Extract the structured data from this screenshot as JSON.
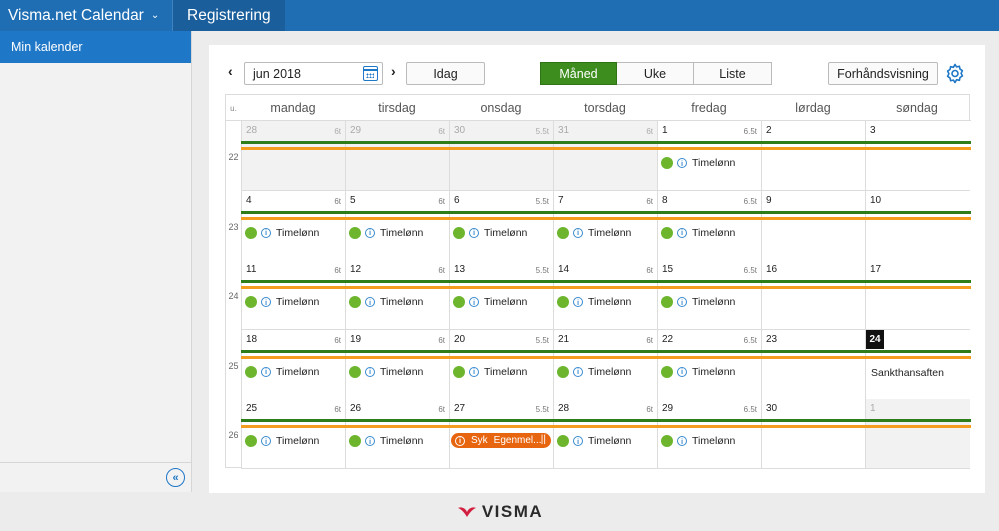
{
  "topbar": {
    "app_name": "Visma.net Calendar",
    "tab": "Registrering"
  },
  "sidebar": {
    "items": [
      {
        "label": "Min kalender"
      }
    ],
    "collapse_icon": "double-chevron-left-icon"
  },
  "toolbar": {
    "prev_icon": "chevron-left-icon",
    "next_icon": "chevron-right-icon",
    "date_value": "jun 2018",
    "today_label": "Idag",
    "views": [
      "Måned",
      "Uke",
      "Liste"
    ],
    "active_view": "Måned",
    "preview_label": "Forhåndsvisning",
    "settings_icon": "gear-icon"
  },
  "calendar": {
    "week_col_label": "u.",
    "day_headers": [
      "mandag",
      "tirsdag",
      "onsdag",
      "torsdag",
      "fredag",
      "lørdag",
      "søndag"
    ],
    "weeks": [
      {
        "num": "22",
        "days": [
          {
            "d": "28",
            "h": "6t",
            "other": true
          },
          {
            "d": "29",
            "h": "6t",
            "other": true
          },
          {
            "d": "30",
            "h": "5.5t",
            "other": true
          },
          {
            "d": "31",
            "h": "6t",
            "other": true
          },
          {
            "d": "1",
            "h": "6.5t",
            "event": "Timelønn"
          },
          {
            "d": "2"
          },
          {
            "d": "3"
          }
        ]
      },
      {
        "num": "23",
        "days": [
          {
            "d": "4",
            "h": "6t",
            "event": "Timelønn"
          },
          {
            "d": "5",
            "h": "6t",
            "event": "Timelønn"
          },
          {
            "d": "6",
            "h": "5.5t",
            "event": "Timelønn"
          },
          {
            "d": "7",
            "h": "6t",
            "event": "Timelønn"
          },
          {
            "d": "8",
            "h": "6.5t",
            "event": "Timelønn"
          },
          {
            "d": "9"
          },
          {
            "d": "10"
          }
        ]
      },
      {
        "num": "24",
        "days": [
          {
            "d": "11",
            "h": "6t",
            "event": "Timelønn"
          },
          {
            "d": "12",
            "h": "6t",
            "event": "Timelønn"
          },
          {
            "d": "13",
            "h": "5.5t",
            "event": "Timelønn"
          },
          {
            "d": "14",
            "h": "6t",
            "event": "Timelønn"
          },
          {
            "d": "15",
            "h": "6.5t",
            "event": "Timelønn"
          },
          {
            "d": "16"
          },
          {
            "d": "17"
          }
        ]
      },
      {
        "num": "25",
        "days": [
          {
            "d": "18",
            "h": "6t",
            "event": "Timelønn"
          },
          {
            "d": "19",
            "h": "6t",
            "event": "Timelønn"
          },
          {
            "d": "20",
            "h": "5.5t",
            "event": "Timelønn"
          },
          {
            "d": "21",
            "h": "6t",
            "event": "Timelønn"
          },
          {
            "d": "22",
            "h": "6.5t",
            "event": "Timelønn"
          },
          {
            "d": "23"
          },
          {
            "d": "24",
            "today": true,
            "holiday": "Sankthansaften"
          }
        ]
      },
      {
        "num": "26",
        "days": [
          {
            "d": "25",
            "h": "6t",
            "event": "Timelønn"
          },
          {
            "d": "26",
            "h": "6t",
            "event": "Timelønn"
          },
          {
            "d": "27",
            "h": "5.5t",
            "sick": {
              "type": "Syk",
              "label": "Egenmel...",
              "end": "||"
            }
          },
          {
            "d": "28",
            "h": "6t",
            "event": "Timelønn"
          },
          {
            "d": "29",
            "h": "6.5t",
            "event": "Timelønn"
          },
          {
            "d": "30"
          },
          {
            "d": "1",
            "other": true
          }
        ]
      }
    ]
  },
  "footer": {
    "logo_text": "VISMA"
  },
  "colors": {
    "brand_blue": "#1f6eb4",
    "active_green": "#3c8c1e",
    "bar_green": "#2e7d1a",
    "bar_orange": "#f39c1f",
    "sick_orange": "#e8650f"
  }
}
